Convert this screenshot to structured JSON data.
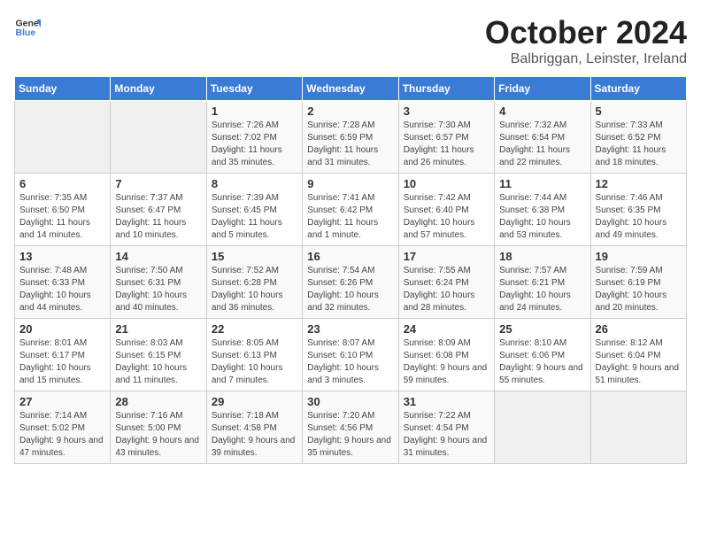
{
  "logo": {
    "text_general": "General",
    "text_blue": "Blue"
  },
  "header": {
    "month": "October 2024",
    "location": "Balbriggan, Leinster, Ireland"
  },
  "weekdays": [
    "Sunday",
    "Monday",
    "Tuesday",
    "Wednesday",
    "Thursday",
    "Friday",
    "Saturday"
  ],
  "weeks": [
    [
      {
        "day": "",
        "detail": ""
      },
      {
        "day": "",
        "detail": ""
      },
      {
        "day": "1",
        "detail": "Sunrise: 7:26 AM\nSunset: 7:02 PM\nDaylight: 11 hours\nand 35 minutes."
      },
      {
        "day": "2",
        "detail": "Sunrise: 7:28 AM\nSunset: 6:59 PM\nDaylight: 11 hours\nand 31 minutes."
      },
      {
        "day": "3",
        "detail": "Sunrise: 7:30 AM\nSunset: 6:57 PM\nDaylight: 11 hours\nand 26 minutes."
      },
      {
        "day": "4",
        "detail": "Sunrise: 7:32 AM\nSunset: 6:54 PM\nDaylight: 11 hours\nand 22 minutes."
      },
      {
        "day": "5",
        "detail": "Sunrise: 7:33 AM\nSunset: 6:52 PM\nDaylight: 11 hours\nand 18 minutes."
      }
    ],
    [
      {
        "day": "6",
        "detail": "Sunrise: 7:35 AM\nSunset: 6:50 PM\nDaylight: 11 hours\nand 14 minutes."
      },
      {
        "day": "7",
        "detail": "Sunrise: 7:37 AM\nSunset: 6:47 PM\nDaylight: 11 hours\nand 10 minutes."
      },
      {
        "day": "8",
        "detail": "Sunrise: 7:39 AM\nSunset: 6:45 PM\nDaylight: 11 hours\nand 5 minutes."
      },
      {
        "day": "9",
        "detail": "Sunrise: 7:41 AM\nSunset: 6:42 PM\nDaylight: 11 hours\nand 1 minute."
      },
      {
        "day": "10",
        "detail": "Sunrise: 7:42 AM\nSunset: 6:40 PM\nDaylight: 10 hours\nand 57 minutes."
      },
      {
        "day": "11",
        "detail": "Sunrise: 7:44 AM\nSunset: 6:38 PM\nDaylight: 10 hours\nand 53 minutes."
      },
      {
        "day": "12",
        "detail": "Sunrise: 7:46 AM\nSunset: 6:35 PM\nDaylight: 10 hours\nand 49 minutes."
      }
    ],
    [
      {
        "day": "13",
        "detail": "Sunrise: 7:48 AM\nSunset: 6:33 PM\nDaylight: 10 hours\nand 44 minutes."
      },
      {
        "day": "14",
        "detail": "Sunrise: 7:50 AM\nSunset: 6:31 PM\nDaylight: 10 hours\nand 40 minutes."
      },
      {
        "day": "15",
        "detail": "Sunrise: 7:52 AM\nSunset: 6:28 PM\nDaylight: 10 hours\nand 36 minutes."
      },
      {
        "day": "16",
        "detail": "Sunrise: 7:54 AM\nSunset: 6:26 PM\nDaylight: 10 hours\nand 32 minutes."
      },
      {
        "day": "17",
        "detail": "Sunrise: 7:55 AM\nSunset: 6:24 PM\nDaylight: 10 hours\nand 28 minutes."
      },
      {
        "day": "18",
        "detail": "Sunrise: 7:57 AM\nSunset: 6:21 PM\nDaylight: 10 hours\nand 24 minutes."
      },
      {
        "day": "19",
        "detail": "Sunrise: 7:59 AM\nSunset: 6:19 PM\nDaylight: 10 hours\nand 20 minutes."
      }
    ],
    [
      {
        "day": "20",
        "detail": "Sunrise: 8:01 AM\nSunset: 6:17 PM\nDaylight: 10 hours\nand 15 minutes."
      },
      {
        "day": "21",
        "detail": "Sunrise: 8:03 AM\nSunset: 6:15 PM\nDaylight: 10 hours\nand 11 minutes."
      },
      {
        "day": "22",
        "detail": "Sunrise: 8:05 AM\nSunset: 6:13 PM\nDaylight: 10 hours\nand 7 minutes."
      },
      {
        "day": "23",
        "detail": "Sunrise: 8:07 AM\nSunset: 6:10 PM\nDaylight: 10 hours\nand 3 minutes."
      },
      {
        "day": "24",
        "detail": "Sunrise: 8:09 AM\nSunset: 6:08 PM\nDaylight: 9 hours\nand 59 minutes."
      },
      {
        "day": "25",
        "detail": "Sunrise: 8:10 AM\nSunset: 6:06 PM\nDaylight: 9 hours\nand 55 minutes."
      },
      {
        "day": "26",
        "detail": "Sunrise: 8:12 AM\nSunset: 6:04 PM\nDaylight: 9 hours\nand 51 minutes."
      }
    ],
    [
      {
        "day": "27",
        "detail": "Sunrise: 7:14 AM\nSunset: 5:02 PM\nDaylight: 9 hours\nand 47 minutes."
      },
      {
        "day": "28",
        "detail": "Sunrise: 7:16 AM\nSunset: 5:00 PM\nDaylight: 9 hours\nand 43 minutes."
      },
      {
        "day": "29",
        "detail": "Sunrise: 7:18 AM\nSunset: 4:58 PM\nDaylight: 9 hours\nand 39 minutes."
      },
      {
        "day": "30",
        "detail": "Sunrise: 7:20 AM\nSunset: 4:56 PM\nDaylight: 9 hours\nand 35 minutes."
      },
      {
        "day": "31",
        "detail": "Sunrise: 7:22 AM\nSunset: 4:54 PM\nDaylight: 9 hours\nand 31 minutes."
      },
      {
        "day": "",
        "detail": ""
      },
      {
        "day": "",
        "detail": ""
      }
    ]
  ]
}
